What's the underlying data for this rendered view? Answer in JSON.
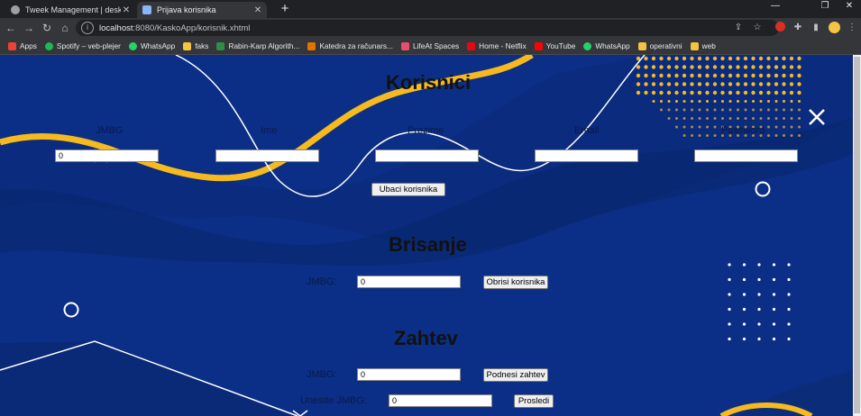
{
  "browser": {
    "tabs": [
      {
        "title": "Tweek Management | desktop-nl"
      },
      {
        "title": "Prijava korisnika"
      }
    ],
    "address": {
      "host": "localhost",
      "path": ":8080/KaskoApp/korisnik.xhtml"
    },
    "bookmarks": [
      "Apps",
      "Spotify – veb-plejer",
      "WhatsApp",
      "faks",
      "Rabin-Karp Algorith...",
      "Katedra za računars...",
      "LifeAt Spaces",
      "Home - Netflix",
      "YouTube",
      "WhatsApp",
      "operativni",
      "web"
    ],
    "colors": {
      "frame": "#202124",
      "toolbar": "#35363a"
    }
  },
  "page": {
    "background_color": "#0b2f86",
    "accent_color": "#f6b91e",
    "korisnici": {
      "heading": "Korisnici",
      "labels": [
        "JMBG",
        "Ime",
        "Prezime",
        "Email",
        "Password"
      ],
      "jmbg_value": "0",
      "submit_label": "Ubaci korisnika"
    },
    "brisanje": {
      "heading": "Brisanje",
      "label": "JMBG:",
      "value": "0",
      "button": "Obrisi korisnika"
    },
    "zahtev": {
      "heading": "Zahtev",
      "label": "JMBG:",
      "value": "0",
      "button": "Podnesi zahtev",
      "label2": "Unesite JMBG:",
      "value2": "0",
      "button2": "Prosledi"
    }
  }
}
